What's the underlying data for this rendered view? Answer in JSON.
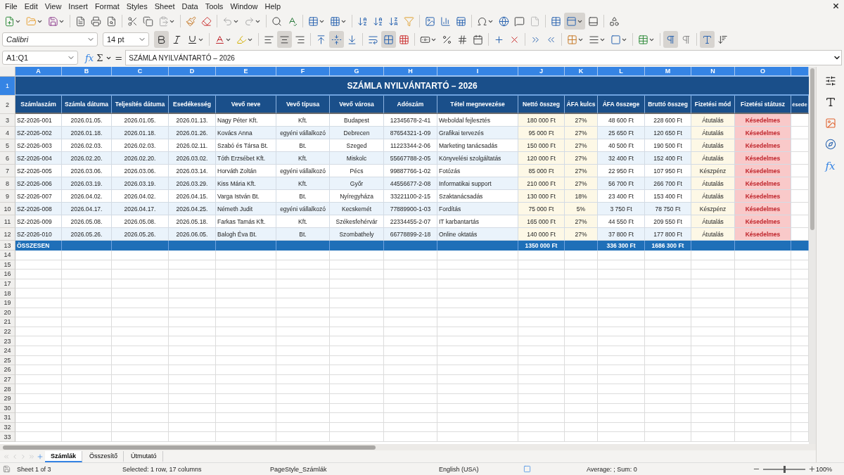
{
  "menu": [
    "File",
    "Edit",
    "View",
    "Insert",
    "Format",
    "Styles",
    "Sheet",
    "Data",
    "Tools",
    "Window",
    "Help"
  ],
  "standard_toolbar": {
    "headers_view_pressed": true
  },
  "formatting_toolbar": {
    "font_name": "Calibri",
    "font_size": "14 pt",
    "bold_pressed": true,
    "align_center_pressed": true,
    "align_middle_pressed": true,
    "merge_pressed": true,
    "ltr_pressed": true,
    "text_direction_pressed": true
  },
  "formula_bar": {
    "name_box": "A1:Q1",
    "function_wizard": "fx",
    "sum": "Σ",
    "equals": "=",
    "content": "SZÁMLA NYILVÁNTARTÓ – 2026"
  },
  "sheet": {
    "column_letters": [
      "A",
      "B",
      "C",
      "D",
      "E",
      "F",
      "G",
      "H",
      "I",
      "J",
      "K",
      "L",
      "M",
      "N",
      "O"
    ],
    "row_numbers": [
      "1",
      "2",
      "3",
      "4",
      "5",
      "6",
      "7",
      "8",
      "9",
      "10",
      "11",
      "12",
      "13",
      "14",
      "15",
      "16",
      "17",
      "18",
      "19",
      "20",
      "21",
      "22",
      "23",
      "24",
      "25",
      "26",
      "27",
      "28",
      "29",
      "30",
      "31",
      "32",
      "33"
    ],
    "title": "SZÁMLA NYILVÁNTARTÓ – 2026",
    "headers": [
      "Számlaszám",
      "Számla dátuma",
      "Teljesítés dátuma",
      "Esedékesség",
      "Vevő neve",
      "Vevő típusa",
      "Vevő városa",
      "Adószám",
      "Tétel megnevezése",
      "Nettó összeg",
      "ÁFA kulcs",
      "ÁFA összege",
      "Bruttó összeg",
      "Fizetési mód",
      "Fizetési státusz",
      "ésede"
    ],
    "rows": [
      [
        "SZ-2026-001",
        "2026.01.05.",
        "2026.01.05.",
        "2026.01.13.",
        "Nagy Péter Kft.",
        "Kft.",
        "Budapest",
        "12345678-2-41",
        "Weboldal fejlesztés",
        "180 000 Ft",
        "27%",
        "48 600 Ft",
        "228 600 Ft",
        "Átutalás",
        "Késedelmes"
      ],
      [
        "SZ-2026-002",
        "2026.01.18.",
        "2026.01.18.",
        "2026.01.26.",
        "Kovács Anna",
        "egyéni vállalkozó",
        "Debrecen",
        "87654321-1-09",
        "Grafikai tervezés",
        "95 000 Ft",
        "27%",
        "25 650 Ft",
        "120 650 Ft",
        "Átutalás",
        "Késedelmes"
      ],
      [
        "SZ-2026-003",
        "2026.02.03.",
        "2026.02.03.",
        "2026.02.11.",
        "Szabó és Társa Bt.",
        "Bt.",
        "Szeged",
        "11223344-2-06",
        "Marketing tanácsadás",
        "150 000 Ft",
        "27%",
        "40 500 Ft",
        "190 500 Ft",
        "Átutalás",
        "Késedelmes"
      ],
      [
        "SZ-2026-004",
        "2026.02.20.",
        "2026.02.20.",
        "2026.03.02.",
        "Tóth Erzsébet Kft.",
        "Kft.",
        "Miskolc",
        "55667788-2-05",
        "Könyvelési szolgáltatás",
        "120 000 Ft",
        "27%",
        "32 400 Ft",
        "152 400 Ft",
        "Átutalás",
        "Késedelmes"
      ],
      [
        "SZ-2026-005",
        "2026.03.06.",
        "2026.03.06.",
        "2026.03.14.",
        "Horváth Zoltán",
        "egyéni vállalkozó",
        "Pécs",
        "99887766-1-02",
        "Fotózás",
        "85 000 Ft",
        "27%",
        "22 950 Ft",
        "107 950 Ft",
        "Készpénz",
        "Késedelmes"
      ],
      [
        "SZ-2026-006",
        "2026.03.19.",
        "2026.03.19.",
        "2026.03.29.",
        "Kiss Mária Kft.",
        "Kft.",
        "Győr",
        "44556677-2-08",
        "Informatikai support",
        "210 000 Ft",
        "27%",
        "56 700 Ft",
        "266 700 Ft",
        "Átutalás",
        "Késedelmes"
      ],
      [
        "SZ-2026-007",
        "2026.04.02.",
        "2026.04.02.",
        "2026.04.15.",
        "Varga István Bt.",
        "Bt.",
        "Nyíregyháza",
        "33221100-2-15",
        "Szaktanácsadás",
        "130 000 Ft",
        "18%",
        "23 400 Ft",
        "153 400 Ft",
        "Átutalás",
        "Késedelmes"
      ],
      [
        "SZ-2026-008",
        "2026.04.17.",
        "2026.04.17.",
        "2026.04.25.",
        "Németh Judit",
        "egyéni vállalkozó",
        "Kecskemét",
        "77889900-1-03",
        "Fordítás",
        "75 000 Ft",
        "5%",
        "3 750 Ft",
        "78 750 Ft",
        "Készpénz",
        "Késedelmes"
      ],
      [
        "SZ-2026-009",
        "2026.05.08.",
        "2026.05.08.",
        "2026.05.18.",
        "Farkas Tamás Kft.",
        "Kft.",
        "Székesfehérvár",
        "22334455-2-07",
        "IT karbantartás",
        "165 000 Ft",
        "27%",
        "44 550 Ft",
        "209 550 Ft",
        "Átutalás",
        "Késedelmes"
      ],
      [
        "SZ-2026-010",
        "2026.05.26.",
        "2026.05.26.",
        "2026.06.05.",
        "Balogh Éva Bt.",
        "Bt.",
        "Szombathely",
        "66778899-2-18",
        "Online oktatás",
        "140 000 Ft",
        "27%",
        "37 800 Ft",
        "177 800 Ft",
        "Átutalás",
        "Késedelmes"
      ]
    ],
    "total": {
      "label": "ÖSSZESEN",
      "net": "1350 000 Ft",
      "vat": "336 300 Ft",
      "gross": "1686 300 Ft"
    }
  },
  "sidebar": {
    "function_label": "fx"
  },
  "sheet_tabs": [
    {
      "label": "Számlák",
      "selected": true
    },
    {
      "label": "Összesítő",
      "selected": false
    },
    {
      "label": "Útmutató",
      "selected": false
    }
  ],
  "status_bar": {
    "sheet": "Sheet 1 of 3",
    "selection": "Selected: 1 row, 17 columns",
    "page_style": "PageStyle_Számlák",
    "language": "English (USA)",
    "summary": "Average: ; Sum: 0",
    "zoom": "100%",
    "zoom_slider": {
      "level": 0.5
    }
  }
}
